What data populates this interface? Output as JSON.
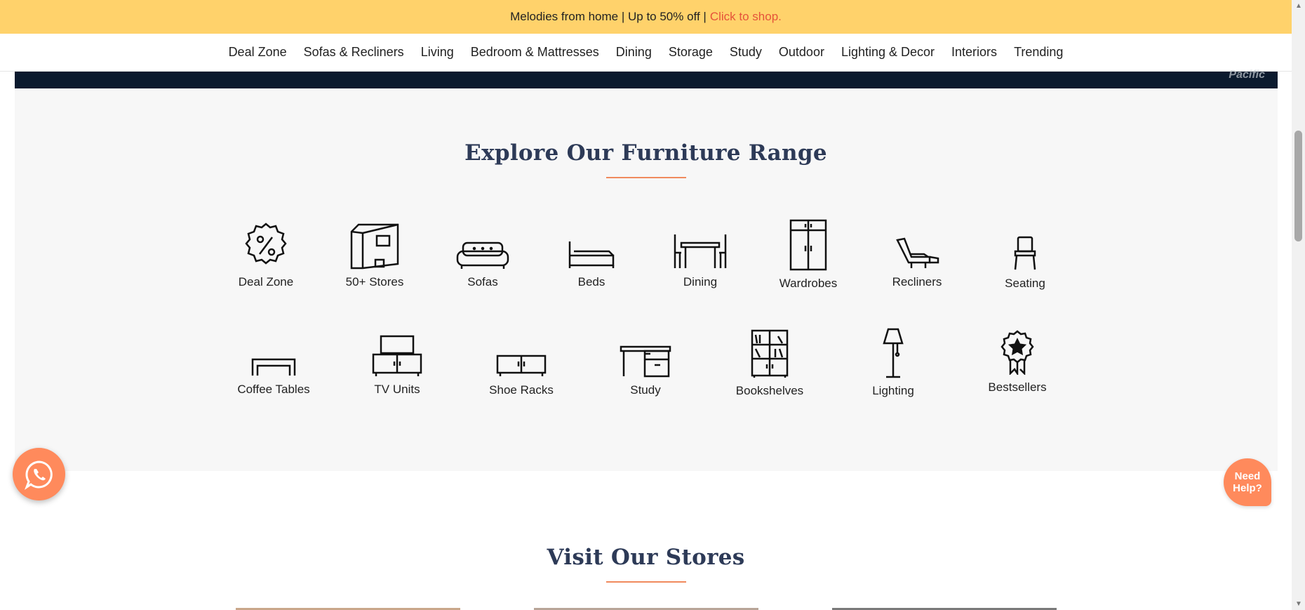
{
  "promo": {
    "text": "Melodies from home | Up to 50% off |",
    "cta": "Click to shop."
  },
  "nav": [
    "Deal Zone",
    "Sofas & Recliners",
    "Living",
    "Bedroom & Mattresses",
    "Dining",
    "Storage",
    "Study",
    "Outdoor",
    "Lighting & Decor",
    "Interiors",
    "Trending"
  ],
  "hero": {
    "watermark": "Pacific"
  },
  "explore": {
    "title": "Explore Our Furniture Range",
    "row1": [
      "Deal Zone",
      "50+ Stores",
      "Sofas",
      "Beds",
      "Dining",
      "Wardrobes",
      "Recliners",
      "Seating"
    ],
    "row2": [
      "Coffee Tables",
      "TV Units",
      "Shoe Racks",
      "Study",
      "Bookshelves",
      "Lighting",
      "Bestsellers"
    ]
  },
  "stores": {
    "title": "Visit Our Stores"
  },
  "help": {
    "line1": "Need",
    "line2": "Help?"
  },
  "colors": {
    "promo_bg": "#ffd26b",
    "accent": "#f08a5d",
    "title": "#2d3a57",
    "cta": "#e5533a"
  }
}
